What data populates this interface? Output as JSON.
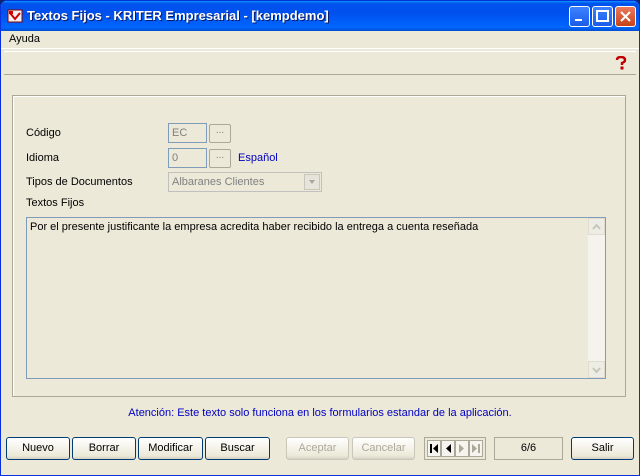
{
  "window": {
    "title": "Textos Fijos - KRITER Empresarial - [kempdemo]"
  },
  "menu": {
    "items": [
      "Ayuda"
    ]
  },
  "toolbar": {
    "help_icon": "help-question-icon"
  },
  "form": {
    "codigo_label": "Código",
    "codigo_value": "EC",
    "idioma_label": "Idioma",
    "idioma_value": "0",
    "idioma_name": "Español",
    "tipos_label": "Tipos de Documentos",
    "tipos_value": "Albaranes Clientes",
    "textos_label": "Textos Fijos",
    "textos_value": "Por el presente justificante la empresa acredita haber recibido la entrega a cuenta reseñada",
    "browse_label": "..."
  },
  "notice": "Atención: Este texto solo funciona en los formularios estandar de la aplicación.",
  "buttons": {
    "nuevo": "Nuevo",
    "borrar": "Borrar",
    "modificar": "Modificar",
    "buscar": "Buscar",
    "aceptar": "Aceptar",
    "cancelar": "Cancelar",
    "salir": "Salir"
  },
  "record_position": "6/6",
  "colors": {
    "titlebar": "#0054e3",
    "link": "#0000c0",
    "face": "#ece9d8"
  }
}
